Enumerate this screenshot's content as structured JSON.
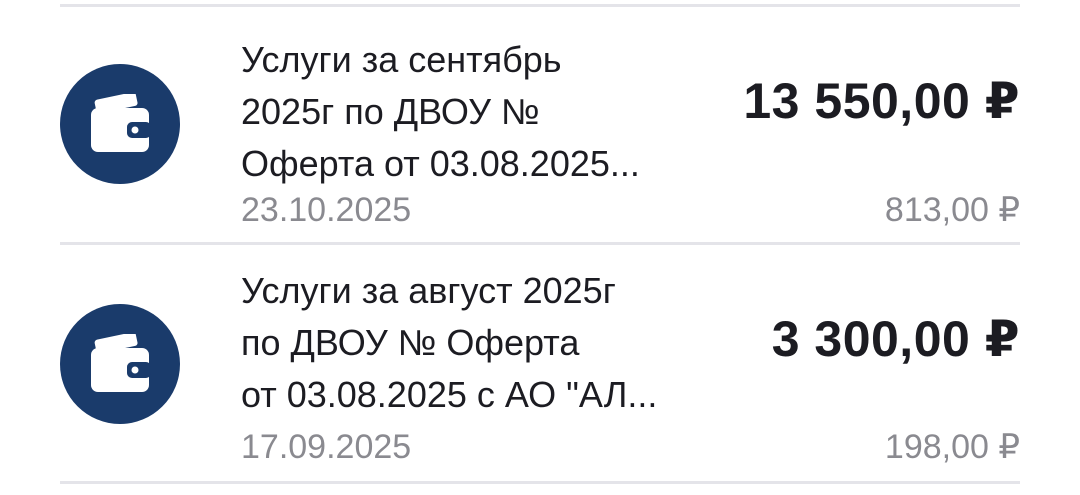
{
  "colors": {
    "avatar_bg": "#1a3b6b",
    "icon": "#ffffff",
    "primary_text": "#1c1c22",
    "secondary_text": "#8a8a90",
    "divider": "#e4e4e9"
  },
  "transactions": [
    {
      "icon": "wallet-icon",
      "title": "Услуги за сентябрь\n2025г по ДВОУ №\nОферта от 03.08.2025...",
      "date": "23.10.2025",
      "amount": "13 550,00 ₽",
      "sub_amount": "813,00 ₽"
    },
    {
      "icon": "wallet-icon",
      "title": "Услуги за август 2025г\nпо ДВОУ № Оферта\nот 03.08.2025 с АО \"АЛ...",
      "date": "17.09.2025",
      "amount": "3 300,00 ₽",
      "sub_amount": "198,00 ₽"
    }
  ]
}
